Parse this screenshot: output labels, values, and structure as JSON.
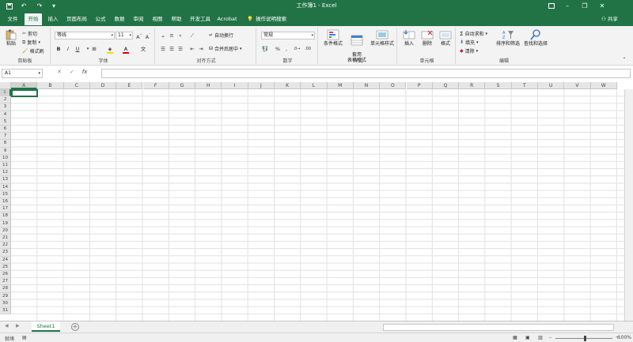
{
  "window": {
    "title": "工作簿1 - Excel",
    "accent": "#217346"
  },
  "quick_access": {
    "icons": [
      "save-icon",
      "undo-icon",
      "redo-icon",
      "customize-icon"
    ]
  },
  "window_controls": {
    "icons": [
      "ribbon-display-icon",
      "minimize-icon",
      "restore-icon",
      "close-icon"
    ]
  },
  "tabs": [
    {
      "label": "文件"
    },
    {
      "label": "开始"
    },
    {
      "label": "插入"
    },
    {
      "label": "页面布局"
    },
    {
      "label": "公式"
    },
    {
      "label": "数据"
    },
    {
      "label": "审阅"
    },
    {
      "label": "视图"
    },
    {
      "label": "帮助"
    },
    {
      "label": "开发工具"
    },
    {
      "label": "Acrobat"
    }
  ],
  "active_tab": "开始",
  "tell_me": "操作说明搜索",
  "share": "共享",
  "ribbon": {
    "clipboard": {
      "label": "剪贴板",
      "paste": "粘贴",
      "cut": "剪切",
      "copy": "复制",
      "format_painter": "格式刷"
    },
    "font": {
      "label": "字体",
      "font_name": "等线",
      "font_size": "11",
      "bold": "B",
      "italic": "I",
      "underline": "U"
    },
    "alignment": {
      "label": "对齐方式",
      "wrap_text": "自动换行",
      "merge_center": "合并后居中"
    },
    "number": {
      "label": "数字",
      "format": "常规",
      "percent": "%"
    },
    "styles": {
      "label": "样式",
      "conditional": "条件格式",
      "table_format": "套用\n表格格式",
      "cell_styles": "单元格样式"
    },
    "cells": {
      "label": "单元格",
      "insert": "插入",
      "delete": "删除",
      "format": "格式"
    },
    "editing": {
      "label": "编辑",
      "autosum": "自动求和",
      "fill": "填充",
      "clear": "清除",
      "sort_filter": "排序和筛选",
      "find_select": "查找和选择"
    }
  },
  "formula_bar": {
    "name_box": "A1",
    "fx": "fx",
    "value": ""
  },
  "grid": {
    "columns": [
      "A",
      "B",
      "C",
      "D",
      "E",
      "F",
      "G",
      "H",
      "I",
      "J",
      "K",
      "L",
      "M",
      "N",
      "O",
      "P",
      "Q",
      "R",
      "S",
      "T",
      "U",
      "V",
      "W"
    ],
    "rows": [
      "1",
      "2",
      "3",
      "4",
      "5",
      "6",
      "7",
      "8",
      "9",
      "10",
      "11",
      "12",
      "13",
      "14",
      "15",
      "16",
      "17",
      "18",
      "19",
      "20",
      "21",
      "22",
      "23",
      "24",
      "25",
      "26",
      "27",
      "28",
      "29",
      "30",
      "31"
    ],
    "active_cell": "A1"
  },
  "sheets": [
    {
      "label": "Sheet1",
      "active": true
    }
  ],
  "status": {
    "ready": "就绪",
    "zoom": "100%"
  }
}
